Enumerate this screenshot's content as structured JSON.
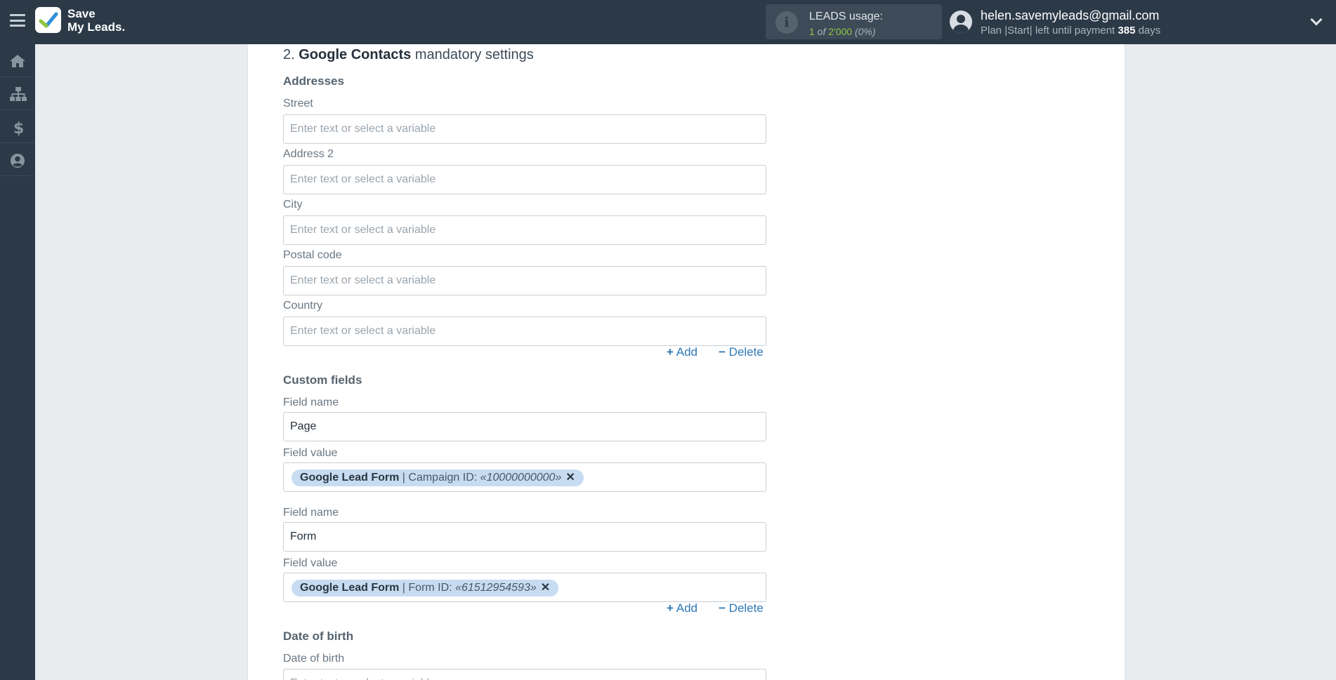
{
  "header": {
    "logo_line1": "Save",
    "logo_line2": "My Leads.",
    "usage_title": "LEADS usage:",
    "usage_used": "1",
    "usage_of": " of ",
    "usage_total": "2'000",
    "usage_pct": " (0%)",
    "user_email": "helen.savemyleads@gmail.com",
    "plan_prefix": "Plan |Start| left until payment ",
    "plan_days": "385",
    "plan_suffix": " days"
  },
  "sidebar": {
    "items": [
      {
        "icon": "home-icon"
      },
      {
        "icon": "sitemap-icon"
      },
      {
        "icon": "dollar-icon"
      },
      {
        "icon": "user-circle-icon"
      }
    ]
  },
  "main": {
    "section_number": "2.",
    "section_service": "Google Contacts",
    "section_suffix": "mandatory settings",
    "addresses": {
      "title": "Addresses",
      "placeholder": "Enter text or select a variable",
      "fields": [
        {
          "label": "Street",
          "value": ""
        },
        {
          "label": "Address 2",
          "value": ""
        },
        {
          "label": "City",
          "value": ""
        },
        {
          "label": "Postal code",
          "value": ""
        },
        {
          "label": "Country",
          "value": ""
        }
      ]
    },
    "add_label": "Add",
    "delete_label": "Delete",
    "custom_fields": {
      "title": "Custom fields",
      "field_name_label": "Field name",
      "field_value_label": "Field value",
      "items": [
        {
          "name": "Page",
          "tag_source": "Google Lead Form",
          "tag_field": " | Campaign ID: ",
          "tag_value": "«10000000000»"
        },
        {
          "name": "Form",
          "tag_source": "Google Lead Form",
          "tag_field": " | Form ID: ",
          "tag_value": "«61512954593»"
        }
      ]
    },
    "date_of_birth": {
      "title": "Date of birth",
      "label": "Date of birth",
      "placeholder": "Enter text or select a variable",
      "value": ""
    }
  }
}
